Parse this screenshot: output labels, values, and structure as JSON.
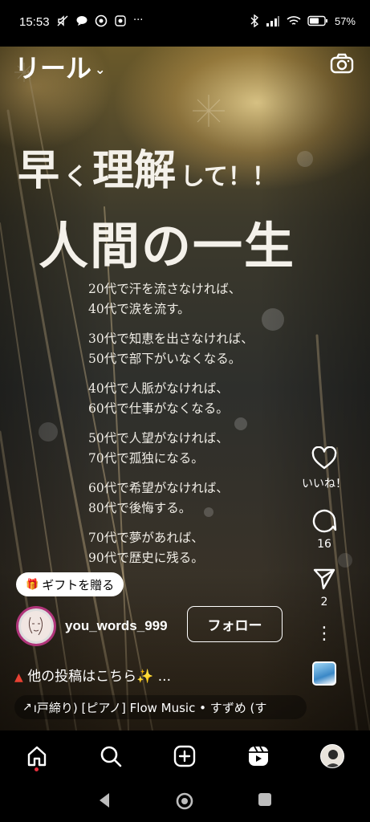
{
  "status_bar": {
    "time": "15:53",
    "battery": "57%",
    "left_icons": [
      "mute-icon",
      "chat-icon",
      "chrome-icon",
      "app-icon",
      "more-dots-icon"
    ],
    "right_icons": [
      "bluetooth-icon",
      "signal-icon",
      "wifi-icon",
      "battery-icon"
    ]
  },
  "header": {
    "title": "リール",
    "camera_icon": "camera-icon"
  },
  "reel_text": {
    "headline_big_1": "早",
    "headline_small_1": "く",
    "headline_big_2": "理解",
    "headline_small_2": "して！！",
    "headline_2": "人間の一生",
    "quotes": [
      [
        "20代で汗を流さなければ、",
        "40代で涙を流す。"
      ],
      [
        "30代で知恵を出さなければ、",
        "50代で部下がいなくなる。"
      ],
      [
        "40代で人脈がなければ、",
        "60代で仕事がなくなる。"
      ],
      [
        "50代で人望がなければ、",
        "70代で孤独になる。"
      ],
      [
        "60代で希望がなければ、",
        "80代で後悔する。"
      ],
      [
        "70代で夢があれば、",
        "90代で歴史に残る。"
      ]
    ]
  },
  "actions": {
    "like_label": "いいね！",
    "comments_count": "16",
    "shares_count": "2"
  },
  "gift": {
    "label": "ギフトを贈る"
  },
  "author": {
    "username": "you_words_999",
    "follow_label": "フォロー"
  },
  "caption": {
    "text": "他の投稿はこちら✨ ..."
  },
  "music": {
    "text": "ı戸締り) [ピアノ]  Flow Music • すずめ (す"
  },
  "colors": {
    "accent_red": "#e8303d",
    "avatar_ring": "#b0357a",
    "caption_triangle": "#e84133"
  }
}
